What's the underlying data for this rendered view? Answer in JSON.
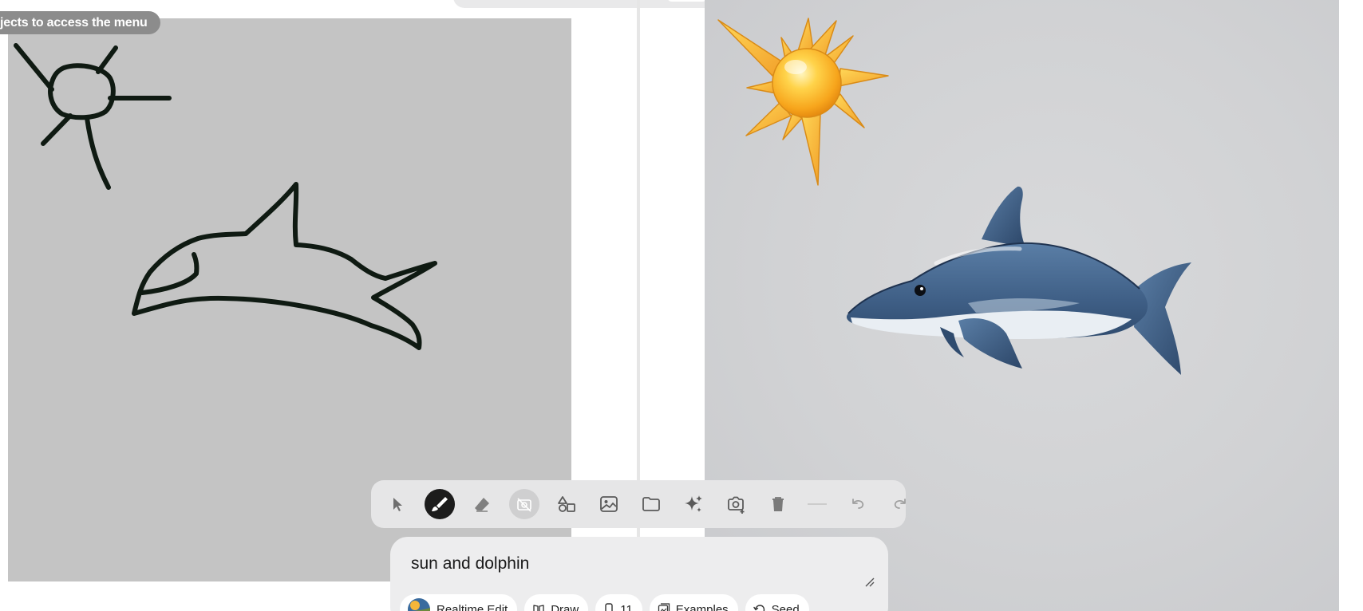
{
  "hint": {
    "text": "jects to access the menu"
  },
  "prompt": {
    "value": "sun and dolphin"
  },
  "toolbar": {
    "tools": [
      {
        "name": "select-tool",
        "icon": "cursor-icon",
        "state": "normal"
      },
      {
        "name": "brush-tool",
        "icon": "brush-icon",
        "state": "active"
      },
      {
        "name": "eraser-tool",
        "icon": "eraser-icon",
        "state": "normal"
      },
      {
        "name": "capture-tool",
        "icon": "camera-off-icon",
        "state": "disabled"
      },
      {
        "name": "shapes-tool",
        "icon": "shapes-icon",
        "state": "normal"
      },
      {
        "name": "image-tool",
        "icon": "image-icon",
        "state": "normal"
      },
      {
        "name": "folder-tool",
        "icon": "folder-icon",
        "state": "normal"
      },
      {
        "name": "ai-tool",
        "icon": "sparkles-icon",
        "state": "normal"
      },
      {
        "name": "snapshot-tool",
        "icon": "camera-plus-icon",
        "state": "normal"
      },
      {
        "name": "delete-tool",
        "icon": "trash-icon",
        "state": "normal"
      },
      {
        "name": "undo-button",
        "icon": "undo-icon",
        "state": "dim"
      },
      {
        "name": "redo-button",
        "icon": "redo-icon",
        "state": "dim"
      }
    ]
  },
  "chips": {
    "realtime_label": "Realtime Edit",
    "draw_label": "Draw",
    "count_label": "11",
    "examples_label": "Examples",
    "seed_label": "Seed"
  },
  "colors": {
    "canvas_bg": "#c4c4c4",
    "stroke": "#0f1a12",
    "toolbar_bg": "#e6e6e7",
    "active_tool": "#1c1c1c"
  }
}
